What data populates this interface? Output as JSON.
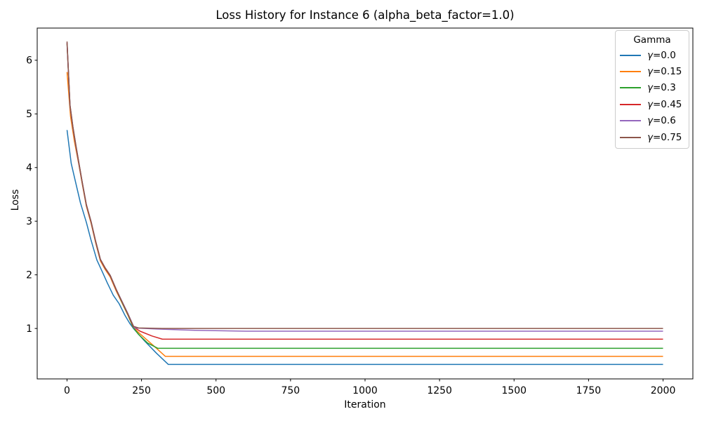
{
  "chart_data": {
    "type": "line",
    "title": "Loss History for Instance 6 (alpha_beta_factor=1.0)",
    "xlabel": "Iteration",
    "ylabel": "Loss",
    "legend_title": "Gamma",
    "legend_position": "upper right",
    "grid": false,
    "xlim": [
      -100,
      2100
    ],
    "ylim": [
      0.06,
      6.6
    ],
    "x_ticks": [
      0,
      250,
      500,
      750,
      1000,
      1250,
      1500,
      1750,
      2000
    ],
    "y_ticks": [
      1,
      2,
      3,
      4,
      5,
      6
    ],
    "spine_color": "#000000",
    "background_color": "#ffffff",
    "series": [
      {
        "label": "γ=0.0",
        "color": "#1f77b4",
        "start_loss": 4.7,
        "final_loss": 0.33,
        "points": [
          [
            0,
            4.7
          ],
          [
            14,
            4.08
          ],
          [
            29,
            3.72
          ],
          [
            45,
            3.34
          ],
          [
            65,
            2.98
          ],
          [
            80,
            2.66
          ],
          [
            100,
            2.28
          ],
          [
            118,
            2.06
          ],
          [
            135,
            1.85
          ],
          [
            155,
            1.62
          ],
          [
            175,
            1.46
          ],
          [
            195,
            1.24
          ],
          [
            210,
            1.1
          ],
          [
            223,
            1.0
          ],
          [
            260,
            0.77
          ],
          [
            300,
            0.54
          ],
          [
            340,
            0.33
          ],
          [
            2000,
            0.33
          ]
        ]
      },
      {
        "label": "γ=0.15",
        "color": "#ff7f0e",
        "start_loss": 5.78,
        "final_loss": 0.48,
        "points": [
          [
            0,
            5.78
          ],
          [
            12,
            4.95
          ],
          [
            25,
            4.48
          ],
          [
            40,
            4.05
          ],
          [
            51,
            3.7
          ],
          [
            65,
            3.28
          ],
          [
            81,
            2.96
          ],
          [
            96,
            2.6
          ],
          [
            112,
            2.26
          ],
          [
            128,
            2.1
          ],
          [
            145,
            1.96
          ],
          [
            165,
            1.7
          ],
          [
            187,
            1.45
          ],
          [
            205,
            1.24
          ],
          [
            222,
            1.02
          ],
          [
            245,
            0.9
          ],
          [
            290,
            0.68
          ],
          [
            330,
            0.48
          ],
          [
            2000,
            0.48
          ]
        ]
      },
      {
        "label": "γ=0.3",
        "color": "#2ca02c",
        "start_loss": 6.31,
        "final_loss": 0.63,
        "points": [
          [
            0,
            6.31
          ],
          [
            10,
            5.15
          ],
          [
            20,
            4.74
          ],
          [
            30,
            4.39
          ],
          [
            40,
            4.07
          ],
          [
            51,
            3.72
          ],
          [
            65,
            3.3
          ],
          [
            81,
            2.98
          ],
          [
            96,
            2.62
          ],
          [
            112,
            2.28
          ],
          [
            128,
            2.12
          ],
          [
            145,
            1.98
          ],
          [
            165,
            1.72
          ],
          [
            187,
            1.46
          ],
          [
            205,
            1.25
          ],
          [
            222,
            1.02
          ],
          [
            240,
            0.89
          ],
          [
            270,
            0.73
          ],
          [
            305,
            0.63
          ],
          [
            2000,
            0.63
          ]
        ]
      },
      {
        "label": "γ=0.45",
        "color": "#d62728",
        "start_loss": 6.32,
        "final_loss": 0.8,
        "points": [
          [
            0,
            6.32
          ],
          [
            10,
            5.15
          ],
          [
            20,
            4.74
          ],
          [
            30,
            4.39
          ],
          [
            40,
            4.07
          ],
          [
            51,
            3.72
          ],
          [
            65,
            3.3
          ],
          [
            81,
            2.98
          ],
          [
            96,
            2.62
          ],
          [
            112,
            2.28
          ],
          [
            128,
            2.12
          ],
          [
            145,
            1.98
          ],
          [
            165,
            1.72
          ],
          [
            187,
            1.47
          ],
          [
            205,
            1.26
          ],
          [
            223,
            1.03
          ],
          [
            245,
            0.95
          ],
          [
            285,
            0.86
          ],
          [
            320,
            0.8
          ],
          [
            2000,
            0.8
          ]
        ]
      },
      {
        "label": "γ=0.6",
        "color": "#9467bd",
        "start_loss": 6.33,
        "final_loss": 0.95,
        "points": [
          [
            0,
            6.33
          ],
          [
            10,
            5.16
          ],
          [
            20,
            4.75
          ],
          [
            30,
            4.4
          ],
          [
            40,
            4.08
          ],
          [
            51,
            3.73
          ],
          [
            65,
            3.31
          ],
          [
            81,
            2.99
          ],
          [
            96,
            2.63
          ],
          [
            112,
            2.29
          ],
          [
            128,
            2.13
          ],
          [
            145,
            1.99
          ],
          [
            165,
            1.73
          ],
          [
            187,
            1.48
          ],
          [
            205,
            1.27
          ],
          [
            226,
            1.01
          ],
          [
            300,
            0.99
          ],
          [
            430,
            0.965
          ],
          [
            600,
            0.95
          ],
          [
            2000,
            0.95
          ]
        ]
      },
      {
        "label": "γ=0.75",
        "color": "#8c564b",
        "start_loss": 6.35,
        "final_loss": 1.0,
        "points": [
          [
            0,
            6.35
          ],
          [
            10,
            5.17
          ],
          [
            20,
            4.76
          ],
          [
            30,
            4.41
          ],
          [
            40,
            4.09
          ],
          [
            51,
            3.73
          ],
          [
            65,
            3.31
          ],
          [
            81,
            2.99
          ],
          [
            96,
            2.63
          ],
          [
            112,
            2.29
          ],
          [
            128,
            2.13
          ],
          [
            145,
            1.99
          ],
          [
            165,
            1.73
          ],
          [
            187,
            1.47
          ],
          [
            205,
            1.26
          ],
          [
            223,
            1.04
          ],
          [
            240,
            1.01
          ],
          [
            320,
            1.0
          ],
          [
            2000,
            1.0
          ]
        ]
      }
    ]
  }
}
